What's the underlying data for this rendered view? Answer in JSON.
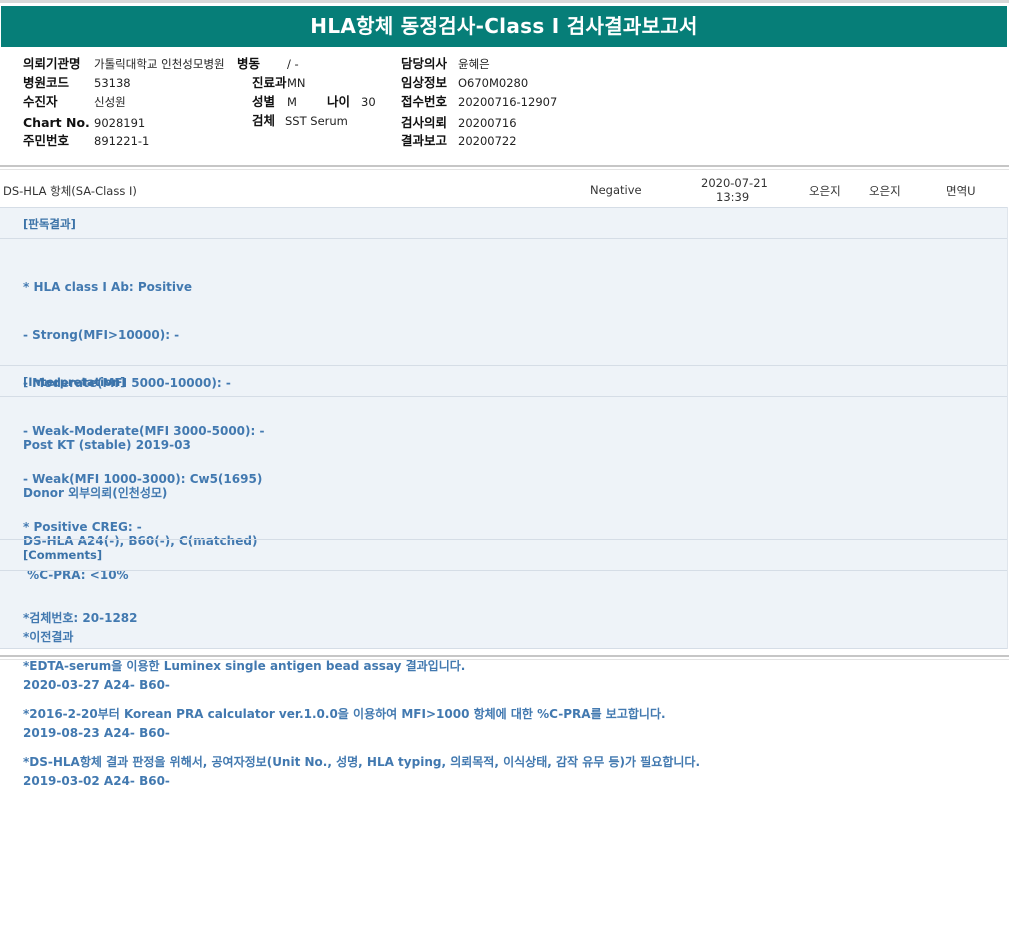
{
  "title": "HLA항체 동정검사-Class I 검사결과보고서",
  "patient": {
    "institution_label": "의뢰기관명",
    "institution": "가톨릭대학교 인천성모병원",
    "ward_label": "병동",
    "ward": "/ -",
    "doctor_label": "담당의사",
    "doctor": "윤혜은",
    "hospital_code_label": "병원코드",
    "hospital_code": "53138",
    "dept_label": "진료과",
    "dept": "MN",
    "clinical_label": "임상정보",
    "clinical": "O670M0280",
    "recipient_label": "수진자",
    "recipient": "신성원",
    "sex_label": "성별",
    "sex": "M",
    "age_label": "나이",
    "age": "30",
    "receipt_label": "접수번호",
    "receipt": "20200716-12907",
    "chart_label": "Chart No.",
    "chart": "9028191",
    "specimen_label": "검체",
    "specimen": "SST Serum",
    "request_label": "검사의뢰",
    "request": "20200716",
    "id_label": "주민번호",
    "id": "891221-1",
    "report_label": "결과보고",
    "report": "20200722"
  },
  "result_row": {
    "test": "DS-HLA 항체(SA-Class I)",
    "result": "Negative",
    "date": "2020-07-21",
    "time": "13:39",
    "person1": "오은지",
    "person2": "오은지",
    "dept": "면역U"
  },
  "sections": {
    "judgement_header": "[판독결과]",
    "judgement_lines": [
      "* HLA class I Ab: Positive",
      "- Strong(MFI>10000): -",
      "- Moderate(MFI 5000-10000): -",
      "- Weak-Moderate(MFI 3000-5000): -",
      "- Weak(MFI 1000-3000): Cw5(1695)",
      "* Positive CREG: -",
      " %C-PRA: <10%"
    ],
    "interpretation_header": "[Interpretation]",
    "interpretation_lines": [
      "Post KT (stable) 2019-03",
      "Donor 외부의뢰(인천성모)",
      "DS-HLA A24(-), B60(-), C(matched)",
      "",
      "*이전결과",
      "2020-03-27 A24- B60-",
      "2019-08-23 A24- B60-",
      "2019-03-02 A24- B60-"
    ],
    "comments_header": "[Comments]",
    "comments_lines": [
      "*검체번호: 20-1282",
      "*EDTA-serum을 이용한 Luminex single antigen bead assay 결과입니다.",
      "*2016-2-20부터 Korean PRA calculator ver.1.0.0을 이용하여 MFI>1000 항체에 대한 %C-PRA를 보고합니다.",
      "*DS-HLA항체 결과 판정을 위해서, 공여자정보(Unit No., 성명, HLA typing, 의뢰목적, 이식상태, 감작 유무 등)가 필요합니다."
    ]
  }
}
